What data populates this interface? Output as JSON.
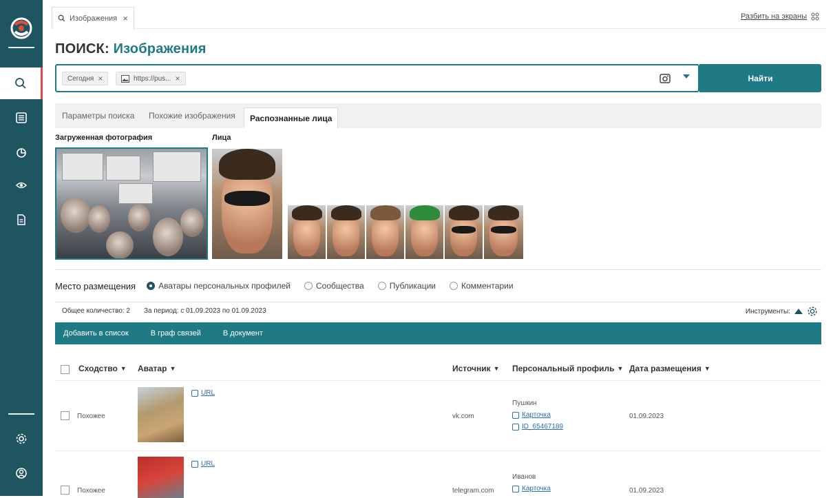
{
  "tabs": [
    {
      "label": "Изображения"
    }
  ],
  "header": {
    "split_label": "Разбить на экраны"
  },
  "page": {
    "title_key": "ПОИСК:",
    "title_value": "Изображения"
  },
  "search": {
    "chips": [
      {
        "label": "Сегодня"
      },
      {
        "label": "https://pus..."
      }
    ],
    "button": "Найти"
  },
  "subtabs": [
    "Параметры поиска",
    "Похожие изображения",
    "Распознанные лица"
  ],
  "sections": {
    "uploaded": "Загруженная фотография",
    "faces": "Лица"
  },
  "placement": {
    "title": "Место размещения",
    "options": [
      "Аватары персональных профилей",
      "Сообщества",
      "Публикации",
      "Комментарии"
    ],
    "selected": 0
  },
  "summary": {
    "total": "Общее количество: 2",
    "period": "За период: с 01.09.2023 по 01.09.2023",
    "tools": "Инструменты:"
  },
  "actions": [
    "Добавить в список",
    "В граф связей",
    "В документ"
  ],
  "table": {
    "headers": [
      "Сходство",
      "Аватар",
      "Источник",
      "Персональный профиль",
      "Дата размещения"
    ],
    "rows": [
      {
        "similarity": "Похожее",
        "url": "URL",
        "source": "vk.com",
        "name": "Пушкин",
        "card": "Карточка",
        "id": "ID_65467189",
        "date": "01.09.2023"
      },
      {
        "similarity": "Похожее",
        "url": "URL",
        "source": "telegram.com",
        "name": "Иванов",
        "card": "Карточка",
        "date": "01.09.2023"
      }
    ]
  },
  "colors": {
    "sidebar": "#1f5560",
    "accent": "#207a86",
    "active_marker": "#e14b3b"
  }
}
